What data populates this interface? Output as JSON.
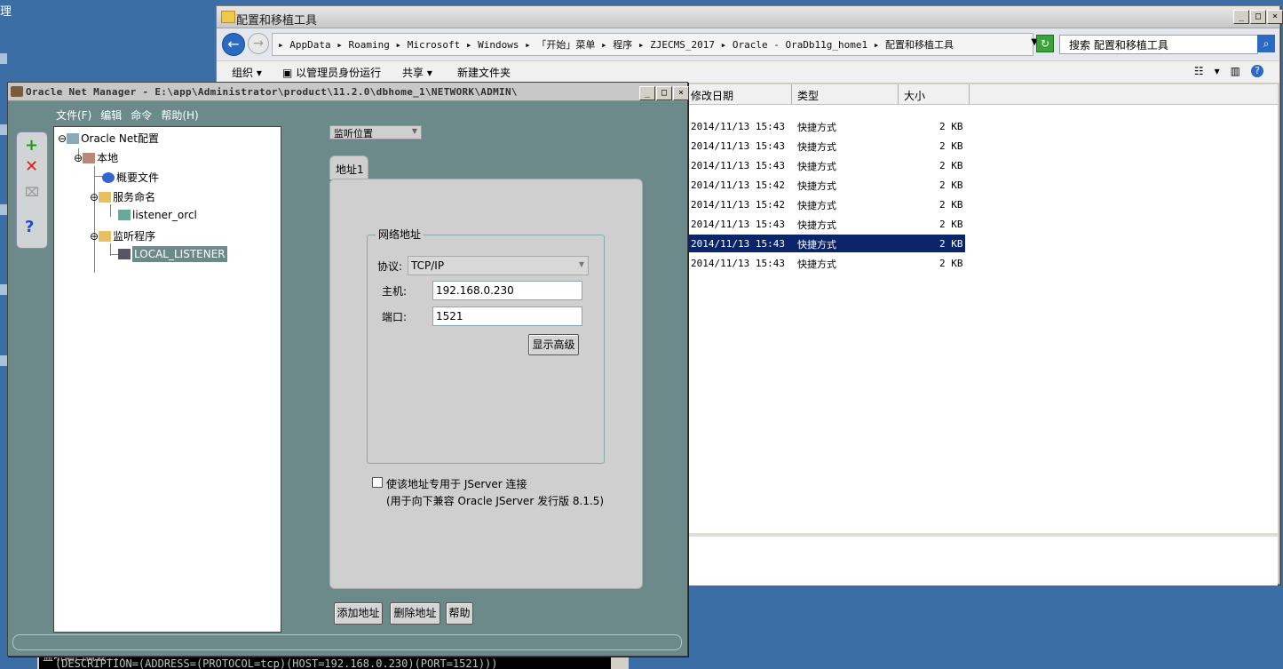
{
  "desktop": {
    "label": "理"
  },
  "console": {
    "line0": "监听端口概要...",
    "line1": "(DESCRIPTION=(ADDRESS=(PROTOCOL=tcp)(HOST=192.168.0.230)(PORT=1521)))"
  },
  "explorer": {
    "title": "配置和移植工具",
    "breadcrumb": "▸ AppData ▸ Roaming ▸ Microsoft ▸ Windows ▸ 「开始」菜单 ▸ 程序 ▸ ZJECMS_2017 ▸ Oracle - OraDb11g_home1 ▸ 配置和移植工具",
    "search_placeholder": "搜索 配置和移植工具",
    "toolbar": {
      "organize": "组织",
      "run_as_admin": "以管理员身份运行",
      "share": "共享",
      "new_folder": "新建文件夹"
    },
    "columns": {
      "modified": "修改日期",
      "type": "类型",
      "size": "大小"
    },
    "files": [
      {
        "date": "2014/11/13 15:43",
        "type": "快捷方式",
        "size": "2 KB"
      },
      {
        "date": "2014/11/13 15:43",
        "type": "快捷方式",
        "size": "2 KB"
      },
      {
        "date": "2014/11/13 15:43",
        "type": "快捷方式",
        "size": "2 KB"
      },
      {
        "date": "2014/11/13 15:42",
        "type": "快捷方式",
        "size": "2 KB"
      },
      {
        "date": "2014/11/13 15:42",
        "type": "快捷方式",
        "size": "2 KB"
      },
      {
        "date": "2014/11/13 15:43",
        "type": "快捷方式",
        "size": "2 KB"
      },
      {
        "date": "2014/11/13 15:43",
        "type": "快捷方式",
        "size": "2 KB"
      },
      {
        "date": "2014/11/13 15:43",
        "type": "快捷方式",
        "size": "2 KB"
      }
    ],
    "selected_row": 6
  },
  "onm": {
    "title": "Oracle Net Manager - E:\\app\\Administrator\\product\\11.2.0\\dbhome_1\\NETWORK\\ADMIN\\",
    "menu": {
      "file": "文件(F)",
      "edit": "编辑",
      "command": "命令",
      "help": "帮助(H)"
    },
    "tree": {
      "root": "Oracle Net配置",
      "local": "本地",
      "profile": "概要文件",
      "service_naming": "服务命名",
      "listener_orcl": "listener_orcl",
      "listeners": "监听程序",
      "local_listener": "LOCAL_LISTENER"
    },
    "view_select": "监听位置",
    "tab": "地址1",
    "group_title": "网络地址",
    "protocol_label": "协议:",
    "protocol_value": "TCP/IP",
    "host_label": "主机:",
    "host_value": "192.168.0.230",
    "port_label": "端口:",
    "port_value": "1521",
    "show_advanced": "显示高级",
    "jserver_check": "使该地址专用于 JServer 连接",
    "jserver_note": "(用于向下兼容 Oracle JServer 发行版 8.1.5)",
    "add_address": "添加地址",
    "delete_address": "删除地址",
    "help_button": "帮助"
  }
}
